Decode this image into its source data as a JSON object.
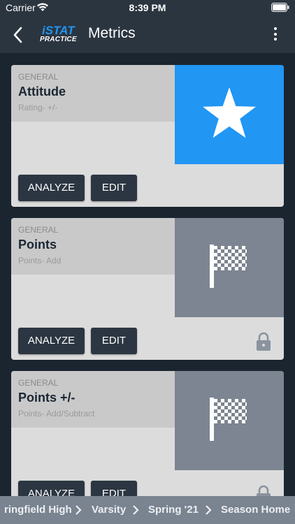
{
  "status_bar": {
    "carrier": "Carrier",
    "time": "8:39 PM",
    "wifi_icon": "wifi-icon",
    "battery_icon": "battery-icon"
  },
  "nav": {
    "back_icon": "chevron-left-icon",
    "logo_top": "iSTAT",
    "logo_bottom": "PRACTICE",
    "title": "Metrics",
    "more_icon": "more-vertical-icon"
  },
  "colors": {
    "nav_bg": "#2b3540",
    "content_bg": "#1a2530",
    "accent_blue": "#2196f3",
    "image_gray": "#7c8591",
    "card_bg": "#dcdcdc",
    "button_bg": "#2c3642"
  },
  "cards": [
    {
      "category": "GENERAL",
      "title": "Attitude",
      "subtitle": "Rating- +/-",
      "image_icon": "star-icon",
      "image_color": "#2196f3",
      "analyze_label": "ANALYZE",
      "edit_label": "EDIT",
      "locked": false
    },
    {
      "category": "GENERAL",
      "title": "Points",
      "subtitle": "Points- Add",
      "image_icon": "checkered-flag-icon",
      "image_color": "#7c8591",
      "analyze_label": "ANALYZE",
      "edit_label": "EDIT",
      "locked": true
    },
    {
      "category": "GENERAL",
      "title": "Points +/-",
      "subtitle": "Points- Add/Subtract",
      "image_icon": "checkered-flag-icon",
      "image_color": "#7c8591",
      "analyze_label": "ANALYZE",
      "edit_label": "EDIT",
      "locked": true
    }
  ],
  "breadcrumb": {
    "items": [
      "ringfield High",
      "Varsity",
      "Spring '21",
      "Season Home"
    ],
    "separator_icon": "chevron-right-icon"
  }
}
